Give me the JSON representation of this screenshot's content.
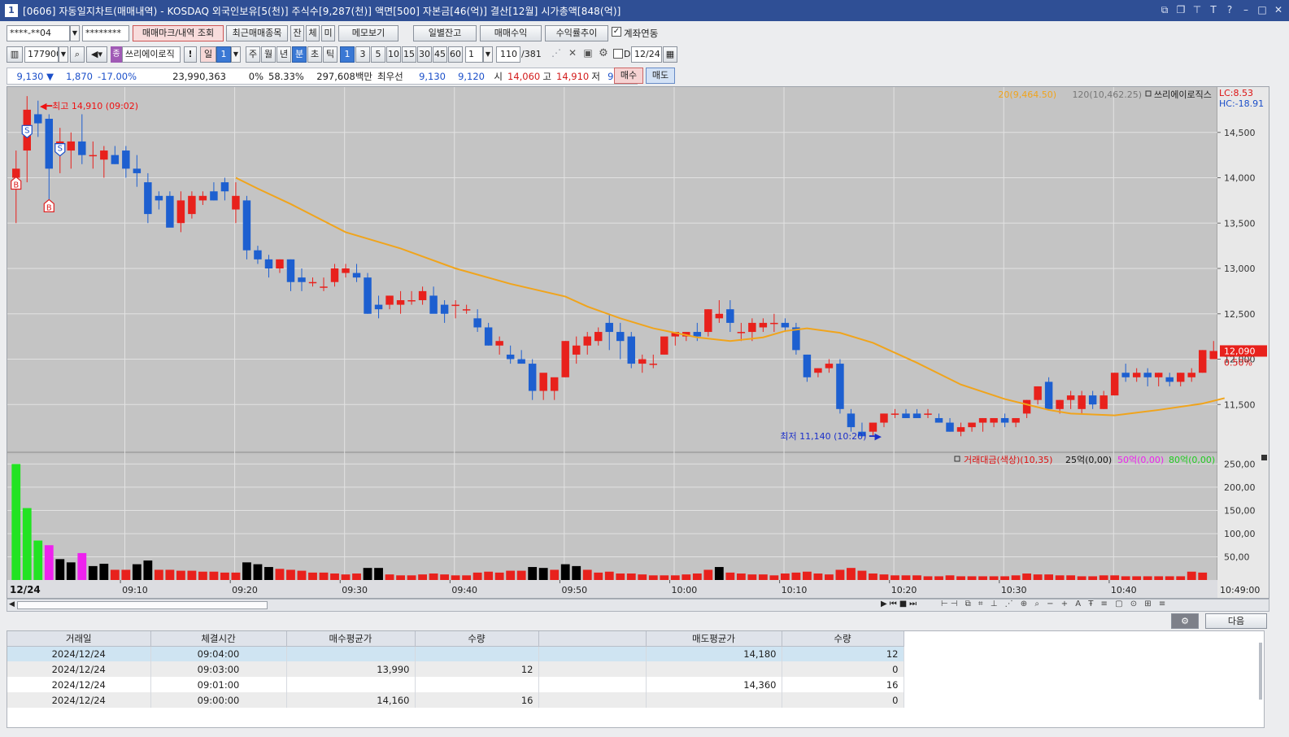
{
  "window": {
    "num": "1",
    "title": "[0606] 자동일지차트(매매내역) - KOSDAQ 외국인보유[5(천)] 주식수[9,287(천)] 액면[500] 자본금[46(억)] 결산[12월] 시가총액[848(억)]"
  },
  "toolbar1": {
    "account": "****-**04",
    "password": "********",
    "mark_btn": "매매마크/내역 조회",
    "recent_btn": "최근매매종목",
    "tab_jan": "잔",
    "tab_che": "체",
    "tab_mi": "미",
    "memo_btn": "메모보기",
    "daily_btn": "일별잔고",
    "profit_btn": "매매수익",
    "rate_btn": "수익률추이",
    "link_label": "계좌연동"
  },
  "toolbar2": {
    "code": "177900",
    "stock_name": "쓰리에이로직",
    "period_il": "일",
    "period_num": "1",
    "p_ju": "주",
    "p_wol": "월",
    "p_nyeon": "년",
    "p_bun": "분",
    "p_cho": "초",
    "p_tik": "틱",
    "int1": "1",
    "int3": "3",
    "int5": "5",
    "int10": "10",
    "int15": "15",
    "int30": "30",
    "int45": "45",
    "int60": "60",
    "count_sel": "1",
    "count_view": "110",
    "count_total": "/381",
    "d_label": "D",
    "date": "12/24"
  },
  "quote": {
    "price": "9,130",
    "arrow": "▼",
    "change": "1,870",
    "change_pct": "-17.00%",
    "volume": "23,990,363",
    "zero_pct": "0%",
    "ratio": "58.33%",
    "amount": "297,608백만",
    "best_label": "최우선",
    "best_sell": "9,130",
    "best_buy": "9,120",
    "open_label": "시",
    "open": "14,060",
    "high_label": "고",
    "high": "14,910",
    "low_label": "저",
    "low": "9,130",
    "buy_btn": "매수",
    "sell_btn": "매도"
  },
  "chart_data": {
    "type": "candlestick",
    "price_axis": {
      "ticks": [
        "14,500",
        "14,000",
        "13,500",
        "13,000",
        "12,500",
        "12,000",
        "11,500"
      ],
      "min": 11000,
      "max": 15000
    },
    "volume_axis": {
      "ticks": [
        "250,00",
        "200,00",
        "150,00",
        "100,00",
        "50,00"
      ],
      "max": 270
    },
    "time_labels": [
      "12/24",
      "09:10",
      "09:20",
      "09:30",
      "09:40",
      "09:50",
      "10:00",
      "10:10",
      "10:20",
      "10:30",
      "10:40",
      "10:49:00"
    ],
    "legend_ma": "20(9,464.50)",
    "legend_ma120": "120(10,462.25)",
    "legend_name": "쓰리에이로직스",
    "lc": "LC:8.53",
    "hc": "HC:-18.91",
    "last_price": "12,090",
    "last_pct": "0.50%",
    "high_note": "최고 14,910 (09:02)",
    "low_note": "최저 11,140 (10:20)",
    "vol_legend_name": "거래대금(색상)(10,35)",
    "vol_legend_25": "25억(0,00)",
    "vol_legend_50": "50억(0,00)",
    "vol_legend_80": "80억(0,00)",
    "colors": {
      "up": "#e8211c",
      "down": "#1d5fd0",
      "ma": "#f0a41c",
      "vol_green": "#22e322",
      "vol_magenta": "#ee22ee",
      "vol_black": "#000000"
    },
    "candles": [
      [
        14000,
        14300,
        13500,
        14100
      ],
      [
        14300,
        14900,
        13950,
        14750
      ],
      [
        14700,
        14850,
        14450,
        14600
      ],
      [
        14650,
        14700,
        13700,
        14100
      ],
      [
        14300,
        14550,
        14050,
        14400
      ],
      [
        14300,
        14500,
        14100,
        14400
      ],
      [
        14400,
        14700,
        14150,
        14250
      ],
      [
        14250,
        14400,
        14100,
        14250
      ],
      [
        14200,
        14350,
        14000,
        14300
      ],
      [
        14250,
        14350,
        14150,
        14150
      ],
      [
        14300,
        14350,
        14000,
        14100
      ],
      [
        14100,
        14250,
        13900,
        14050
      ],
      [
        13950,
        14050,
        13500,
        13600
      ],
      [
        13800,
        13850,
        13650,
        13750
      ],
      [
        13800,
        13850,
        13650,
        13450
      ],
      [
        13500,
        13850,
        13400,
        13750
      ],
      [
        13600,
        13850,
        13550,
        13800
      ],
      [
        13750,
        13850,
        13700,
        13800
      ],
      [
        13850,
        13950,
        13750,
        13750
      ],
      [
        13950,
        14000,
        13750,
        13850
      ],
      [
        13650,
        13950,
        13500,
        13800
      ],
      [
        13750,
        13800,
        13100,
        13200
      ],
      [
        13200,
        13250,
        13050,
        13100
      ],
      [
        13100,
        13150,
        12900,
        13000
      ],
      [
        13000,
        13100,
        12950,
        13100
      ],
      [
        13100,
        13100,
        12750,
        12850
      ],
      [
        12900,
        13000,
        12750,
        12850
      ],
      [
        12850,
        12900,
        12800,
        12850
      ],
      [
        12800,
        12900,
        12750,
        12800
      ],
      [
        12850,
        13050,
        12800,
        13000
      ],
      [
        12950,
        13050,
        12900,
        13000
      ],
      [
        12950,
        13050,
        12850,
        12900
      ],
      [
        12900,
        12950,
        12500,
        12500
      ],
      [
        12600,
        12700,
        12450,
        12550
      ],
      [
        12600,
        12700,
        12550,
        12700
      ],
      [
        12600,
        12750,
        12500,
        12650
      ],
      [
        12650,
        12750,
        12600,
        12650
      ],
      [
        12650,
        12800,
        12600,
        12750
      ],
      [
        12700,
        12800,
        12550,
        12500
      ],
      [
        12600,
        12650,
        12400,
        12500
      ],
      [
        12600,
        12650,
        12450,
        12600
      ],
      [
        12550,
        12600,
        12500,
        12550
      ],
      [
        12450,
        12550,
        12300,
        12350
      ],
      [
        12350,
        12400,
        12150,
        12150
      ],
      [
        12150,
        12250,
        12050,
        12200
      ],
      [
        12050,
        12150,
        11950,
        12000
      ],
      [
        12000,
        12100,
        11950,
        11950
      ],
      [
        11950,
        12000,
        11550,
        11650
      ],
      [
        11650,
        11800,
        11550,
        11850
      ],
      [
        11650,
        11650,
        11550,
        11800
      ],
      [
        11800,
        12200,
        11800,
        12200
      ],
      [
        12050,
        12250,
        11950,
        12150
      ],
      [
        12150,
        12300,
        12050,
        12250
      ],
      [
        12200,
        12350,
        12150,
        12300
      ],
      [
        12400,
        12500,
        12100,
        12300
      ],
      [
        12300,
        12400,
        12000,
        12200
      ],
      [
        12250,
        12300,
        11900,
        11950
      ],
      [
        11950,
        12050,
        11850,
        12000
      ],
      [
        11950,
        12050,
        11900,
        11950
      ],
      [
        12050,
        12200,
        12050,
        12250
      ],
      [
        12250,
        12300,
        12150,
        12300
      ],
      [
        12250,
        12300,
        12200,
        12300
      ],
      [
        12300,
        12400,
        12200,
        12250
      ],
      [
        12300,
        12550,
        12250,
        12550
      ],
      [
        12450,
        12650,
        12400,
        12500
      ],
      [
        12550,
        12650,
        12300,
        12400
      ],
      [
        12300,
        12400,
        12200,
        12300
      ],
      [
        12300,
        12450,
        12200,
        12400
      ],
      [
        12350,
        12450,
        12300,
        12400
      ],
      [
        12400,
        12500,
        12300,
        12400
      ],
      [
        12400,
        12450,
        12300,
        12350
      ],
      [
        12350,
        12400,
        12050,
        12100
      ],
      [
        12050,
        12050,
        11750,
        11800
      ],
      [
        11850,
        11900,
        11800,
        11900
      ],
      [
        11900,
        12000,
        11850,
        11950
      ],
      [
        11950,
        12000,
        11400,
        11450
      ],
      [
        11400,
        11450,
        11200,
        11250
      ],
      [
        11200,
        11300,
        11150,
        11150
      ],
      [
        11200,
        11300,
        11150,
        11300
      ],
      [
        11300,
        11400,
        11250,
        11400
      ],
      [
        11400,
        11450,
        11350,
        11400
      ],
      [
        11400,
        11450,
        11350,
        11350
      ],
      [
        11400,
        11450,
        11350,
        11350
      ],
      [
        11400,
        11450,
        11350,
        11400
      ],
      [
        11350,
        11400,
        11300,
        11300
      ],
      [
        11300,
        11350,
        11200,
        11200
      ],
      [
        11200,
        11300,
        11150,
        11250
      ],
      [
        11250,
        11300,
        11200,
        11300
      ],
      [
        11300,
        11350,
        11200,
        11350
      ],
      [
        11300,
        11350,
        11250,
        11350
      ],
      [
        11350,
        11400,
        11250,
        11300
      ],
      [
        11300,
        11350,
        11250,
        11350
      ],
      [
        11400,
        11550,
        11350,
        11550
      ],
      [
        11550,
        11700,
        11500,
        11700
      ],
      [
        11750,
        11800,
        11650,
        11450
      ],
      [
        11450,
        11550,
        11400,
        11550
      ],
      [
        11550,
        11650,
        11450,
        11600
      ],
      [
        11450,
        11650,
        11400,
        11600
      ],
      [
        11600,
        11650,
        11450,
        11500
      ],
      [
        11450,
        11650,
        11450,
        11600
      ],
      [
        11600,
        11850,
        11600,
        11850
      ],
      [
        11850,
        11950,
        11750,
        11800
      ],
      [
        11800,
        11900,
        11750,
        11850
      ],
      [
        11850,
        11900,
        11700,
        11800
      ],
      [
        11800,
        11850,
        11700,
        11850
      ],
      [
        11800,
        11850,
        11700,
        11750
      ],
      [
        11750,
        11850,
        11700,
        11850
      ],
      [
        11800,
        11900,
        11750,
        11850
      ],
      [
        11850,
        12100,
        11850,
        12100
      ],
      [
        12000,
        12200,
        12000,
        12090
      ]
    ],
    "ma": [
      [
        20,
        14000
      ],
      [
        22,
        13880
      ],
      [
        25,
        13710
      ],
      [
        30,
        13400
      ],
      [
        35,
        13220
      ],
      [
        40,
        13000
      ],
      [
        45,
        12830
      ],
      [
        50,
        12690
      ],
      [
        52,
        12580
      ],
      [
        55,
        12450
      ],
      [
        58,
        12340
      ],
      [
        60,
        12290
      ],
      [
        62,
        12240
      ],
      [
        65,
        12200
      ],
      [
        68,
        12240
      ],
      [
        70,
        12310
      ],
      [
        72,
        12340
      ],
      [
        75,
        12290
      ],
      [
        78,
        12180
      ],
      [
        82,
        11960
      ],
      [
        86,
        11720
      ],
      [
        90,
        11560
      ],
      [
        94,
        11440
      ],
      [
        96,
        11400
      ],
      [
        100,
        11380
      ],
      [
        104,
        11440
      ],
      [
        108,
        11510
      ],
      [
        110,
        11570
      ]
    ],
    "volumes": [
      [
        250,
        "g"
      ],
      [
        155,
        "g"
      ],
      [
        85,
        "g"
      ],
      [
        75,
        "m"
      ],
      [
        45,
        "k"
      ],
      [
        38,
        "k"
      ],
      [
        58,
        "m"
      ],
      [
        30,
        "k"
      ],
      [
        35,
        "k"
      ],
      [
        22,
        "r"
      ],
      [
        22,
        "r"
      ],
      [
        34,
        "k"
      ],
      [
        42,
        "k"
      ],
      [
        22,
        "r"
      ],
      [
        22,
        "r"
      ],
      [
        20,
        "r"
      ],
      [
        20,
        "r"
      ],
      [
        18,
        "r"
      ],
      [
        18,
        "r"
      ],
      [
        16,
        "r"
      ],
      [
        16,
        "r"
      ],
      [
        38,
        "k"
      ],
      [
        34,
        "k"
      ],
      [
        28,
        "k"
      ],
      [
        24,
        "r"
      ],
      [
        22,
        "r"
      ],
      [
        20,
        "r"
      ],
      [
        16,
        "r"
      ],
      [
        16,
        "r"
      ],
      [
        14,
        "r"
      ],
      [
        12,
        "r"
      ],
      [
        14,
        "r"
      ],
      [
        26,
        "k"
      ],
      [
        26,
        "k"
      ],
      [
        12,
        "r"
      ],
      [
        10,
        "r"
      ],
      [
        10,
        "r"
      ],
      [
        12,
        "r"
      ],
      [
        14,
        "r"
      ],
      [
        12,
        "r"
      ],
      [
        10,
        "r"
      ],
      [
        10,
        "r"
      ],
      [
        16,
        "r"
      ],
      [
        18,
        "r"
      ],
      [
        16,
        "r"
      ],
      [
        20,
        "r"
      ],
      [
        20,
        "r"
      ],
      [
        28,
        "k"
      ],
      [
        26,
        "k"
      ],
      [
        22,
        "r"
      ],
      [
        34,
        "k"
      ],
      [
        30,
        "k"
      ],
      [
        22,
        "r"
      ],
      [
        16,
        "r"
      ],
      [
        18,
        "r"
      ],
      [
        14,
        "r"
      ],
      [
        14,
        "r"
      ],
      [
        12,
        "r"
      ],
      [
        10,
        "r"
      ],
      [
        10,
        "r"
      ],
      [
        10,
        "r"
      ],
      [
        12,
        "r"
      ],
      [
        14,
        "r"
      ],
      [
        22,
        "r"
      ],
      [
        28,
        "k"
      ],
      [
        16,
        "r"
      ],
      [
        14,
        "r"
      ],
      [
        12,
        "r"
      ],
      [
        12,
        "r"
      ],
      [
        10,
        "r"
      ],
      [
        14,
        "r"
      ],
      [
        16,
        "r"
      ],
      [
        18,
        "r"
      ],
      [
        14,
        "r"
      ],
      [
        12,
        "r"
      ],
      [
        22,
        "r"
      ],
      [
        26,
        "r"
      ],
      [
        20,
        "r"
      ],
      [
        14,
        "r"
      ],
      [
        12,
        "r"
      ],
      [
        10,
        "r"
      ],
      [
        10,
        "r"
      ],
      [
        10,
        "r"
      ],
      [
        8,
        "r"
      ],
      [
        8,
        "r"
      ],
      [
        10,
        "r"
      ],
      [
        8,
        "r"
      ],
      [
        8,
        "r"
      ],
      [
        8,
        "r"
      ],
      [
        8,
        "r"
      ],
      [
        8,
        "r"
      ],
      [
        10,
        "r"
      ],
      [
        14,
        "r"
      ],
      [
        12,
        "r"
      ],
      [
        12,
        "r"
      ],
      [
        10,
        "r"
      ],
      [
        10,
        "r"
      ],
      [
        8,
        "r"
      ],
      [
        8,
        "r"
      ],
      [
        10,
        "r"
      ],
      [
        10,
        "r"
      ],
      [
        8,
        "r"
      ],
      [
        8,
        "r"
      ],
      [
        8,
        "r"
      ],
      [
        8,
        "r"
      ],
      [
        8,
        "r"
      ],
      [
        8,
        "r"
      ],
      [
        18,
        "r"
      ],
      [
        16,
        "r"
      ]
    ],
    "marks": [
      {
        "i": 0,
        "t": "B",
        "price": 14000
      },
      {
        "i": 1,
        "t": "S",
        "price": 14450
      },
      {
        "i": 3,
        "t": "B",
        "price": 13750
      },
      {
        "i": 4,
        "t": "S",
        "price": 14250
      }
    ]
  },
  "bottom": {
    "next_btn": "다음"
  },
  "table": {
    "headers": [
      "거래일",
      "체결시간",
      "매수평균가",
      "수량",
      "",
      "매도평균가",
      "수량"
    ],
    "rows": [
      [
        "2024/12/24",
        "09:04:00",
        "",
        "",
        "",
        "14,180",
        "12"
      ],
      [
        "2024/12/24",
        "09:03:00",
        "13,990",
        "12",
        "",
        "",
        "0"
      ],
      [
        "2024/12/24",
        "09:01:00",
        "",
        "",
        "",
        "14,360",
        "16"
      ],
      [
        "2024/12/24",
        "09:00:00",
        "14,160",
        "16",
        "",
        "",
        "0"
      ]
    ]
  }
}
